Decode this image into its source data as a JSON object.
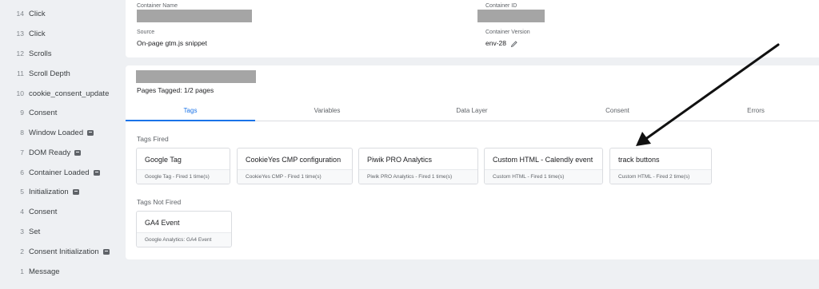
{
  "sidebar": {
    "events": [
      {
        "num": "14",
        "label": "Click",
        "badge": false
      },
      {
        "num": "13",
        "label": "Click",
        "badge": false
      },
      {
        "num": "12",
        "label": "Scrolls",
        "badge": false
      },
      {
        "num": "11",
        "label": "Scroll Depth",
        "badge": false
      },
      {
        "num": "10",
        "label": "cookie_consent_update",
        "badge": false
      },
      {
        "num": "9",
        "label": "Consent",
        "badge": false
      },
      {
        "num": "8",
        "label": "Window Loaded",
        "badge": true
      },
      {
        "num": "7",
        "label": "DOM Ready",
        "badge": true
      },
      {
        "num": "6",
        "label": "Container Loaded",
        "badge": true
      },
      {
        "num": "5",
        "label": "Initialization",
        "badge": true
      },
      {
        "num": "4",
        "label": "Consent",
        "badge": false
      },
      {
        "num": "3",
        "label": "Set",
        "badge": false
      },
      {
        "num": "2",
        "label": "Consent Initialization",
        "badge": true
      },
      {
        "num": "1",
        "label": "Message",
        "badge": false
      }
    ]
  },
  "container": {
    "name_label": "Container Name",
    "id_label": "Container ID",
    "source_label": "Source",
    "source_value": "On-page gtm.js snippet",
    "version_label": "Container Version",
    "version_value": "env-28"
  },
  "summary": {
    "pages_tagged": "Pages Tagged: 1/2 pages"
  },
  "tabs": [
    {
      "label": "Tags",
      "active": true
    },
    {
      "label": "Variables",
      "active": false
    },
    {
      "label": "Data Layer",
      "active": false
    },
    {
      "label": "Consent",
      "active": false
    },
    {
      "label": "Errors",
      "active": false
    }
  ],
  "tags_fired": {
    "title": "Tags Fired",
    "items": [
      {
        "name": "Google Tag",
        "sub": "Google Tag - Fired 1 time(s)"
      },
      {
        "name": "CookieYes CMP configuration",
        "sub": "CookieYes CMP - Fired 1 time(s)"
      },
      {
        "name": "Piwik PRO Analytics",
        "sub": "Piwik PRO Analytics - Fired 1 time(s)"
      },
      {
        "name": "Custom HTML - Calendly event",
        "sub": "Custom HTML - Fired 1 time(s)"
      },
      {
        "name": "track buttons",
        "sub": "Custom HTML - Fired 2 time(s)"
      }
    ]
  },
  "tags_not_fired": {
    "title": "Tags Not Fired",
    "items": [
      {
        "name": "GA4 Event",
        "sub": "Google Analytics: GA4 Event"
      }
    ]
  },
  "colors": {
    "accent": "#1a73e8",
    "redaction": "#a5a5a5",
    "annotation_arrow": "#111111"
  },
  "icons": {
    "edit": "pencil-icon",
    "event_badge": "gtm-event-badge-icon"
  }
}
